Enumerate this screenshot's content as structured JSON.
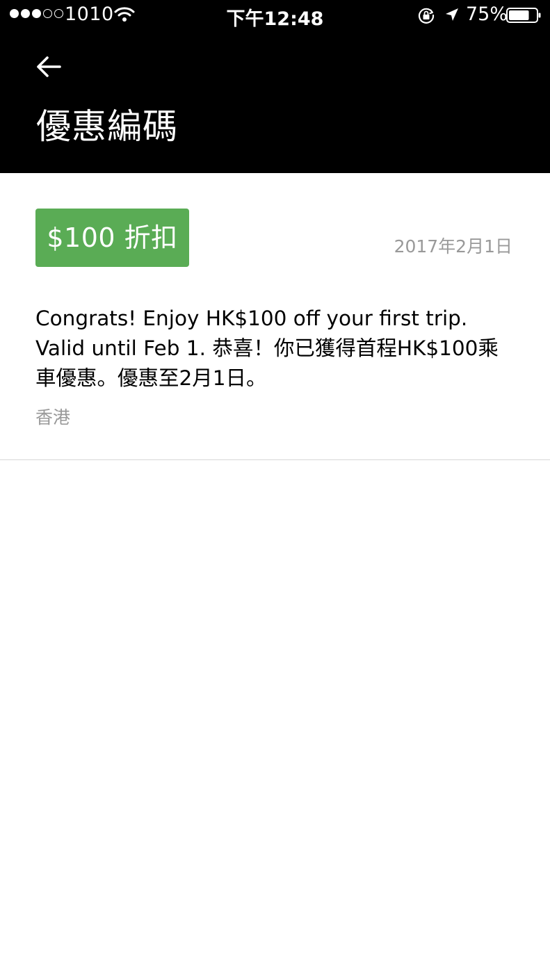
{
  "status_bar": {
    "carrier": "1010",
    "time": "下午12:48",
    "battery_percent": "75%",
    "battery_level": 0.75,
    "signal_bars_filled": 3,
    "signal_bars_total": 5
  },
  "nav": {
    "back_icon": "arrow-left-icon",
    "title": "優惠編碼"
  },
  "promo": {
    "badge_label": "$100 折扣",
    "expiry_date": "2017年2月1日",
    "message": "Congrats!  Enjoy HK$100 off your first trip. Valid until Feb 1. 恭喜！你已獲得首程HK$100乘車優惠。優惠至2月1日。",
    "region": "香港"
  },
  "colors": {
    "header_bg": "#000000",
    "badge_green": "#5aac55",
    "muted_text": "#999999",
    "divider": "#d6d6d6"
  }
}
